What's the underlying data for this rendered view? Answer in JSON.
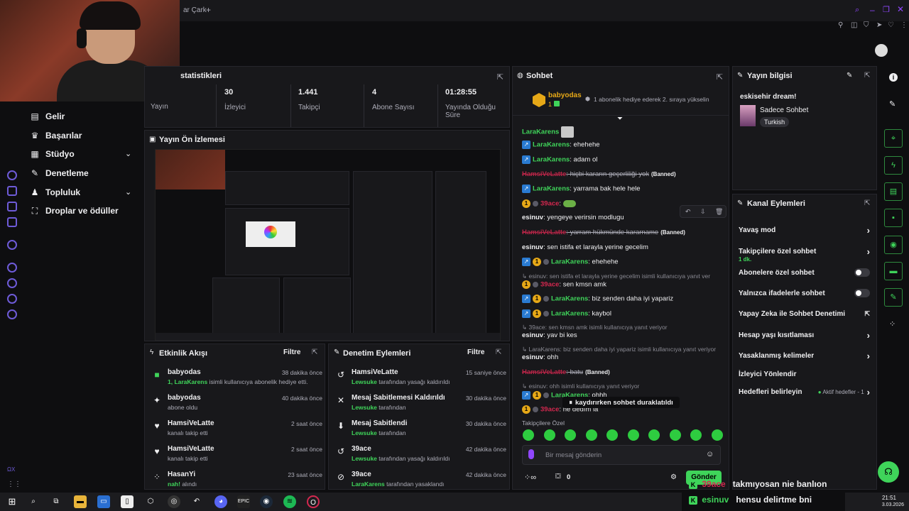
{
  "browser": {
    "tab_title": "ar Çark",
    "new_tab": "+"
  },
  "nav": {
    "items": [
      {
        "label": "Gelir",
        "icon": "bar-chart-icon"
      },
      {
        "label": "Başarılar",
        "icon": "trophy-icon"
      },
      {
        "label": "Stüdyo",
        "icon": "studio-icon"
      },
      {
        "label": "Denetleme",
        "icon": "wrench-icon"
      },
      {
        "label": "Topluluk",
        "icon": "people-icon"
      },
      {
        "label": "Droplar ve ödüller",
        "icon": "drops-icon"
      }
    ]
  },
  "stats": {
    "title": "statistikleri",
    "cells": [
      {
        "value": "",
        "label": "Yayın"
      },
      {
        "value": "30",
        "label": "İzleyici"
      },
      {
        "value": "1.441",
        "label": "Takipçi"
      },
      {
        "value": "4",
        "label": "Abone Sayısı"
      },
      {
        "value": "01:28:55",
        "label": "Yayında Olduğu Süre"
      }
    ]
  },
  "preview": {
    "title": "Yayın Ön İzlemesi"
  },
  "activity": {
    "title": "Etkinlik Akışı",
    "filter": "Filtre",
    "items": [
      {
        "name": "babyodas",
        "sub_hl": "1, LaraKarens",
        "sub": " isimli kullanıcıya abonelik hediye etti.",
        "time": "38 dakika önce",
        "icon": "gift-icon"
      },
      {
        "name": "babyodas",
        "sub_hl": "",
        "sub": "abone oldu",
        "time": "40 dakika önce",
        "icon": "star-icon"
      },
      {
        "name": "HamsiVeLatte",
        "sub_hl": "",
        "sub": "kanalı takip etti",
        "time": "2 saat önce",
        "icon": "heart-icon"
      },
      {
        "name": "HamsiVeLatte",
        "sub_hl": "",
        "sub": "kanalı takip etti",
        "time": "2 saat önce",
        "icon": "heart-icon"
      },
      {
        "name": "HasanYi",
        "sub_hl": "nah!",
        "sub": " alındı",
        "time": "23 saat önce",
        "icon": "drops-icon"
      }
    ]
  },
  "modlog": {
    "title": "Denetim Eylemleri",
    "filter": "Filtre",
    "items": [
      {
        "name": "HamsiVeLatte",
        "sub_hl": "Lewsuke",
        "sub": " tarafından yasağı kaldırıldı",
        "time": "15 saniye önce",
        "icon": "undo-icon"
      },
      {
        "name": "Mesaj Sabitlemesi Kaldırıldı",
        "sub_hl": "Lewsuke",
        "sub": " tarafından",
        "time": "30 dakika önce",
        "icon": "unpin-icon"
      },
      {
        "name": "Mesaj Sabitlendi",
        "sub_hl": "Lewsuke",
        "sub": " tarafından",
        "time": "30 dakika önce",
        "icon": "pin-icon"
      },
      {
        "name": "39ace",
        "sub_hl": "Lewsuke",
        "sub": " tarafından yasağı kaldırıldı",
        "time": "42 dakika önce",
        "icon": "undo-icon"
      },
      {
        "name": "39ace",
        "sub_hl": "LaraKarens",
        "sub": " tarafından yasaklandı",
        "time": "42 dakika önce",
        "icon": "ban-icon"
      }
    ]
  },
  "chat": {
    "title": "Sohbet",
    "pinned_user": "babyodas",
    "pinned_count": "1",
    "pinned_msg": "1 abonelik hediye ederek 2. sıraya yükselin",
    "paused": "kaydırırken sohbet duraklatıldı",
    "followers_only": "Takipçilere Özel",
    "placeholder": "Bir mesaj gönderin",
    "points": "0",
    "send": "Gönder",
    "messages": [
      {
        "name": "LaraKarens",
        "text": "",
        "style": "green",
        "badge": "none"
      },
      {
        "name": "LaraKarens",
        "text": ": ehehehe",
        "style": "green",
        "badge": "vip"
      },
      {
        "name": "LaraKarens",
        "text": ": adam ol",
        "style": "green",
        "badge": "vip"
      },
      {
        "name": "HamsiVeLatte",
        "text": ": hiçbi kararın geçerliliği yok",
        "style": "banned",
        "badge": "none",
        "tag": "(Banned)"
      },
      {
        "name": "LaraKarens",
        "text": ": yarrama bak hele hele",
        "style": "green",
        "badge": "vip"
      },
      {
        "name": "39ace",
        "text": ":",
        "style": "red",
        "badge": "gold"
      },
      {
        "name": "esinuv",
        "text": ": yengeye verirsin modlugu",
        "style": "gray",
        "badge": "none"
      },
      {
        "name": "HamsiVeLatte",
        "text": ": yarram hükmünde kararname",
        "style": "banned",
        "badge": "none",
        "tag": "(Banned)"
      },
      {
        "name": "esinuv",
        "text": ": sen istifa et larayla yerine gecelim",
        "style": "gray",
        "badge": "none"
      },
      {
        "name": "LaraKarens",
        "text": ": ehehehe",
        "style": "green",
        "badge": "vipgold"
      },
      {
        "name": "",
        "text": "esinuv: sen istifa et larayla yerine gecelim isimli kullanıcıya yanıt ver",
        "style": "reply",
        "badge": "none"
      },
      {
        "name": "39ace",
        "text": ": sen kmsn amk",
        "style": "red",
        "badge": "gold"
      },
      {
        "name": "LaraKarens",
        "text": ": biz senden daha iyi yapariz",
        "style": "green",
        "badge": "vipgold"
      },
      {
        "name": "LaraKarens",
        "text": ": kaybol",
        "style": "green",
        "badge": "vipgold"
      },
      {
        "name": "",
        "text": "39ace: sen kmsn amk isimli kullanıcıya yanıt veriyor",
        "style": "reply",
        "badge": "none"
      },
      {
        "name": "esinuv",
        "text": ": yav bi kes",
        "style": "gray",
        "badge": "none"
      },
      {
        "name": "",
        "text": "LaraKarens: biz senden daha iyi yapariz isimli kullanıcıya yanıt veriyor",
        "style": "reply",
        "badge": "none"
      },
      {
        "name": "esinuv",
        "text": ": ohh",
        "style": "gray",
        "badge": "none"
      },
      {
        "name": "HamsiVeLatte",
        "text": ": batu",
        "style": "banned",
        "badge": "none",
        "tag": "(Banned)"
      },
      {
        "name": "",
        "text": "esinuv: ohh isimli kullanıcıya yanıt veriyor",
        "style": "reply",
        "badge": "none"
      },
      {
        "name": "LaraKarens",
        "text": ": ohhh",
        "style": "green",
        "badge": "vipgold"
      },
      {
        "name": "39ace",
        "text": ": he dedım la",
        "style": "red",
        "badge": "gold"
      }
    ]
  },
  "streaminfo": {
    "title": "Yayın bilgisi",
    "stream_title": "eskisehir dream!",
    "category": "Sadece Sohbet",
    "tag": "Turkish"
  },
  "channel_actions": {
    "title": "Kanal Eylemleri",
    "rows": [
      {
        "label": "Yavaş mod",
        "control": "chevron",
        "sub": ""
      },
      {
        "label": "Takipçilere özel sohbet",
        "control": "chevron",
        "sub": "1 dk."
      },
      {
        "label": "Abonelere özel sohbet",
        "control": "toggle",
        "sub": ""
      },
      {
        "label": "Yalnızca ifadelerle sohbet",
        "control": "toggle",
        "sub": ""
      },
      {
        "label": "Yapay Zeka ile Sohbet Denetimi",
        "control": "external",
        "sub": ""
      },
      {
        "label": "Hesap yaşı kısıtlaması",
        "control": "chevron",
        "sub": ""
      },
      {
        "label": "Yasaklanmış kelimeler",
        "control": "chevron",
        "sub": ""
      },
      {
        "label": "İzleyici Yönlendir",
        "control": "none",
        "sub": ""
      },
      {
        "label": "Hedefleri belirleyin",
        "control": "chevron",
        "sub": "Aktif hedefler - 1"
      }
    ]
  },
  "overlay": {
    "lines": [
      {
        "name": "39ace",
        "text": "takmıyosan nie banlıon"
      },
      {
        "name": "esinuv",
        "text": "hensu delirtme bni"
      }
    ]
  },
  "taskbar": {
    "time": "21:51",
    "date": "3.03.2026"
  },
  "colors": {
    "accent_green": "#3fd45a",
    "accent_purple": "#9147ff",
    "banned_red": "#d3284f",
    "vip_blue": "#2a7bd1"
  }
}
